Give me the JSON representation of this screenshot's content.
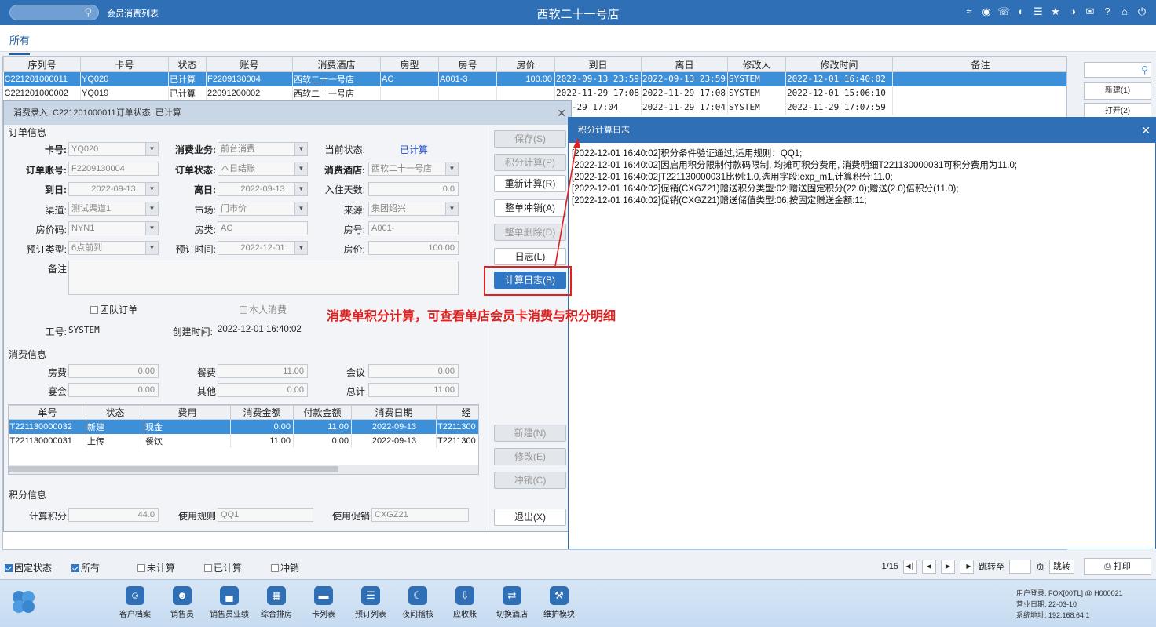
{
  "topbar": {
    "module": "会员消费列表",
    "store_title": "西软二十一号店",
    "icons": [
      "wifi-icon",
      "chat-icon",
      "phone-icon",
      "palette-icon",
      "menu-icon",
      "star-icon",
      "contrast-icon",
      "mail-icon",
      "help-icon",
      "home-icon",
      "power-icon"
    ]
  },
  "tabs": {
    "all": "所有"
  },
  "main_table": {
    "columns": [
      "序列号",
      "卡号",
      "状态",
      "账号",
      "消费酒店",
      "房型",
      "房号",
      "房价",
      "到日",
      "离日",
      "修改人",
      "修改时间",
      "备注"
    ],
    "rows": [
      [
        "C221201000011",
        "YQ020",
        "已计算",
        "F2209130004",
        "西软二十一号店",
        "AC",
        "A001-3",
        "100.00",
        "2022-09-13 23:59",
        "2022-09-13 23:59",
        "SYSTEM",
        "2022-12-01 16:40:02",
        ""
      ],
      [
        "C221201000002",
        "YQ019",
        "已计算",
        "22091200002",
        "西软二十一号店",
        "",
        "",
        "",
        "2022-11-29 17:08",
        "2022-11-29 17:08",
        "SYSTEM",
        "2022-12-01 15:06:10",
        ""
      ],
      [
        "",
        "",
        "",
        "",
        "",
        "",
        "",
        "",
        "-11-29 17:04",
        "2022-11-29 17:04",
        "SYSTEM",
        "2022-11-29 17:07:59",
        ""
      ]
    ]
  },
  "side_panel": {
    "new": "新建(1)",
    "open": "打开(2)"
  },
  "dialog": {
    "title": "消费录入: C221201000011订单状态: 已计算",
    "sections": {
      "order": "订单信息",
      "consume": "消费信息",
      "points": "积分信息"
    },
    "labels": {
      "card_no": "卡号:",
      "biz": "消费业务:",
      "cur_status": "当前状态:",
      "order_acct": "订单账号:",
      "order_status": "订单状态:",
      "hotel": "消费酒店:",
      "arr": "到日:",
      "dep": "离日:",
      "nights": "入住天数:",
      "channel": "渠道:",
      "market": "市场:",
      "source": "来源:",
      "rate_code": "房价码:",
      "room_type": "房类:",
      "room_no": "房号:",
      "book_type": "预订类型:",
      "book_time": "预订时间:",
      "rate": "房价:",
      "remark": "备注",
      "worker": "工号:",
      "created": "创建时间:"
    },
    "values": {
      "card_no": "YQ020",
      "biz": "前台消费",
      "cur_status": "已计算",
      "order_acct": "F2209130004",
      "order_status": "本日结账",
      "hotel": "西软二十一号店",
      "arr": "2022-09-13",
      "dep": "2022-09-13",
      "nights": "0.0",
      "channel": "测试渠道1",
      "market": "门市价",
      "source": "集团绍兴",
      "rate_code": "NYN1",
      "room_type": "AC",
      "room_no": "A001-",
      "book_type": "6点前到",
      "book_time": "2022-12-01",
      "rate": "100.00",
      "worker": "SYSTEM",
      "created": "2022-12-01 16:40:02"
    },
    "checks": {
      "group": "团队订单",
      "self": "本人消费"
    },
    "consume": {
      "labels": {
        "room": "房费",
        "meal": "餐费",
        "meeting": "会议",
        "banquet": "宴会",
        "other": "其他",
        "total": "总计"
      },
      "values": {
        "room": "0.00",
        "meal": "11.00",
        "meeting": "0.00",
        "banquet": "0.00",
        "other": "0.00",
        "total": "11.00"
      }
    },
    "detail_table": {
      "columns": [
        "单号",
        "状态",
        "费用",
        "消费金额",
        "付款金额",
        "消费日期",
        "经"
      ],
      "rows": [
        [
          "T221130000032",
          "新建",
          "现金",
          "0.00",
          "11.00",
          "2022-09-13",
          "T2211300"
        ],
        [
          "T221130000031",
          "上传",
          "餐饮",
          "11.00",
          "0.00",
          "2022-09-13",
          "T2211300"
        ]
      ]
    },
    "points": {
      "labels": {
        "calc": "计算积分",
        "rule": "使用规则",
        "promo": "使用促销"
      },
      "values": {
        "calc": "44.0",
        "rule": "QQ1",
        "promo": "CXGZ21"
      }
    },
    "buttons": {
      "save": "保存(S)",
      "points_calc": "积分计算(P)",
      "recalc": "重新计算(R)",
      "reverse_all": "整单冲销(A)",
      "delete_all": "整单删除(D)",
      "log": "日志(L)",
      "calc_log": "计算日志(B)",
      "new": "新建(N)",
      "modify": "修改(E)",
      "reverse": "冲销(C)",
      "exit": "退出(X)"
    }
  },
  "log_dialog": {
    "title": "积分计算日志",
    "lines": [
      "[2022-12-01 16:40:02]积分条件验证通过,适用规则：QQ1;",
      "[2022-12-01 16:40:02]因启用积分限制付款码限制, 均摊可积分费用, 消费明细T221130000031可积分费用为11.0;",
      "[2022-12-01 16:40:02]T221130000031比例:1.0,选用字段:exp_m1,计算积分:11.0;",
      "[2022-12-01 16:40:02]促销(CXGZ21)赠送积分类型:02;赠送固定积分(22.0);赠送(2.0)倍积分(11.0);",
      "[2022-12-01 16:40:02]促销(CXGZ21)赠送储值类型:06;按固定赠送金额:11;"
    ]
  },
  "annotation": {
    "text": "消费单积分计算，可查看单店会员卡消费与积分明细",
    "color": "#e02020"
  },
  "filter_bar": {
    "fixed": "固定状态",
    "all": "所有",
    "uncalc": "未计算",
    "calc": "已计算",
    "reverse": "冲销",
    "page": "1/15",
    "jump_to": "跳转至",
    "page_unit": "页",
    "jump": "跳转",
    "print": "打印"
  },
  "footer": {
    "buttons": [
      {
        "label": "客户档案",
        "icon": "profile-icon"
      },
      {
        "label": "销售员",
        "icon": "person-icon"
      },
      {
        "label": "销售员业绩",
        "icon": "bar-chart-icon"
      },
      {
        "label": "综合排房",
        "icon": "grid-icon"
      },
      {
        "label": "卡列表",
        "icon": "card-icon"
      },
      {
        "label": "预订列表",
        "icon": "list-icon"
      },
      {
        "label": "夜间稽核",
        "icon": "moon-icon"
      },
      {
        "label": "应收账",
        "icon": "download-icon"
      },
      {
        "label": "切换酒店",
        "icon": "switch-icon"
      },
      {
        "label": "维护模块",
        "icon": "wrench-icon"
      }
    ],
    "user_login": "用户登录:  FOX[00TL] @ H000021",
    "business_date": "营业日期:  22-03-10",
    "system_address": "系统地址:  192.168.64.1"
  },
  "colors": {
    "primary": "#2f6fb5",
    "selected_row": "#3d8fd8",
    "annotation": "#e02020"
  }
}
